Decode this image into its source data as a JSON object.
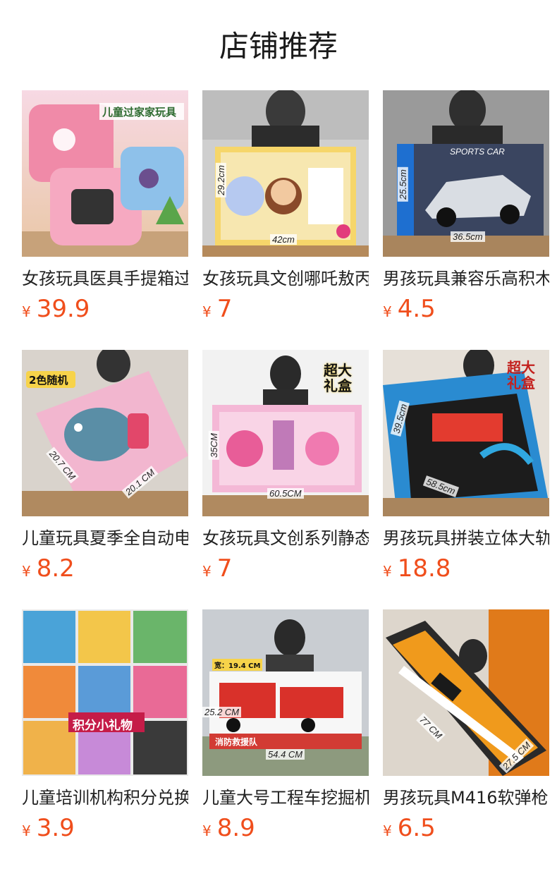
{
  "page": {
    "title": "店铺推荐"
  },
  "colors": {
    "price": "#f04e1c",
    "text": "#222222"
  },
  "products": [
    {
      "name": "女孩玩具医具手提箱过家家玩具",
      "currency": "¥",
      "price": "39.9",
      "image_icon": "doctor-kit-toy-icon",
      "image_text": [
        "儿童过家家玩具"
      ],
      "theme": "#f3b6c8"
    },
    {
      "name": "女孩玩具文创哪吒敖丙手工DIY",
      "currency": "¥",
      "price": "7",
      "image_icon": "diy-craft-box-icon",
      "image_text": [
        "29.2cm",
        "42cm"
      ],
      "theme": "#f6d66a"
    },
    {
      "name": "男孩玩具兼容乐高积木跑车",
      "currency": "¥",
      "price": "4.5",
      "image_icon": "race-car-box-icon",
      "image_text": [
        "25.5cm",
        "36.5cm",
        "SPORTS CAR"
      ],
      "theme": "#5d6c8a"
    },
    {
      "name": "儿童玩具夏季全自动电动泡泡机",
      "currency": "¥",
      "price": "8.2",
      "image_icon": "water-gun-box-icon",
      "image_text": [
        "2色随机",
        "20.7 CM",
        "20.1 CM"
      ],
      "theme": "#e8a9c4"
    },
    {
      "name": "女孩玩具文创系列静态贴纸礼盒",
      "currency": "¥",
      "price": "7",
      "image_icon": "gift-box-icon",
      "image_text": [
        "超大礼盒",
        "35CM",
        "60.5CM"
      ],
      "theme": "#f4b8d6"
    },
    {
      "name": "男孩玩具拼装立体大轨道车",
      "currency": "¥",
      "price": "18.8",
      "image_icon": "track-set-box-icon",
      "image_text": [
        "超大礼盒",
        "39.5cm",
        "58.5cm"
      ],
      "theme": "#2a8bd1"
    },
    {
      "name": "儿童培训机构积分兑换小礼物",
      "currency": "¥",
      "price": "3.9",
      "image_icon": "gift-collage-icon",
      "image_text": [
        "积分小礼物"
      ],
      "theme": "#c94b6a"
    },
    {
      "name": "儿童大号工程车挖掘机消防车",
      "currency": "¥",
      "price": "8.9",
      "image_icon": "fire-truck-box-icon",
      "image_text": [
        "宽：19.4 CM",
        "25.2 CM",
        "54.4 CM",
        "消防救援队"
      ],
      "theme": "#d23b34"
    },
    {
      "name": "男孩玩具M416软弹枪",
      "currency": "¥",
      "price": "6.5",
      "image_icon": "toy-gun-box-icon",
      "image_text": [
        "77 CM",
        "27.5 CM"
      ],
      "theme": "#f09a1c"
    }
  ]
}
